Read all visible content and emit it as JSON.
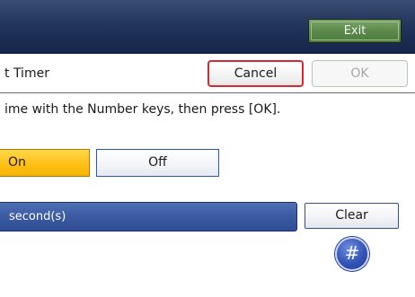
{
  "header": {
    "exit_label": "Exit"
  },
  "title_row": {
    "title": "t Timer",
    "cancel_label": "Cancel",
    "ok_label": "OK"
  },
  "instruction": "ime with the Number keys, then press [OK].",
  "toggle": {
    "on_label": "On",
    "off_label": "Off",
    "selected": "On"
  },
  "input": {
    "unit_label": "second(s)",
    "clear_label": "Clear"
  },
  "hash_key": {
    "label": "#"
  },
  "colors": {
    "header_bg": "#22355a",
    "exit_green": "#5d8a4c",
    "cancel_border": "#d12a32",
    "selected_yellow": "#ffc21a",
    "field_blue": "#3b5aa2",
    "hash_blue": "#3454b8"
  }
}
